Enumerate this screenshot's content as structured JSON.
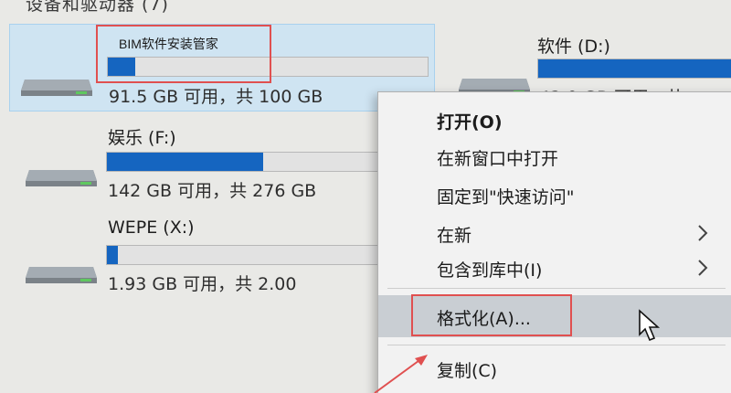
{
  "section_header": "设备和驱动器 (7)",
  "drives": [
    {
      "name": "",
      "usage": "91.5 GB 可用，共 100 GB",
      "used_fraction": 0.085
    },
    {
      "name": "软件 (D:)",
      "usage": "42.0 GB 可用，共",
      "used_fraction": 0.95
    },
    {
      "name": "娱乐 (F:)",
      "usage": "142 GB 可用，共 276 GB",
      "used_fraction": 0.49
    },
    {
      "name": "WEPE (X:)",
      "usage": "1.93 GB 可用，共 2.00",
      "used_fraction": 0.035
    }
  ],
  "annotation_text": "BIM软件安装管家",
  "context_menu": {
    "items": [
      {
        "label": "打开(O)",
        "bold": true,
        "submenu": false
      },
      {
        "label": "在新窗口中打开",
        "bold": false,
        "submenu": false
      },
      {
        "label": "固定到\"快速访问\"",
        "bold": false,
        "submenu": false
      },
      {
        "label": "在新",
        "bold": false,
        "submenu": true
      },
      {
        "label": "包含到库中(I)",
        "bold": false,
        "submenu": true
      },
      {
        "label": "格式化(A)...",
        "bold": false,
        "submenu": false,
        "highlighted": true
      },
      {
        "label": "复制(C)",
        "bold": false,
        "submenu": false
      }
    ]
  },
  "colors": {
    "bar_fill": "#1565c0",
    "annotation": "#e05050",
    "selected_bg": "#cfe4f2"
  }
}
